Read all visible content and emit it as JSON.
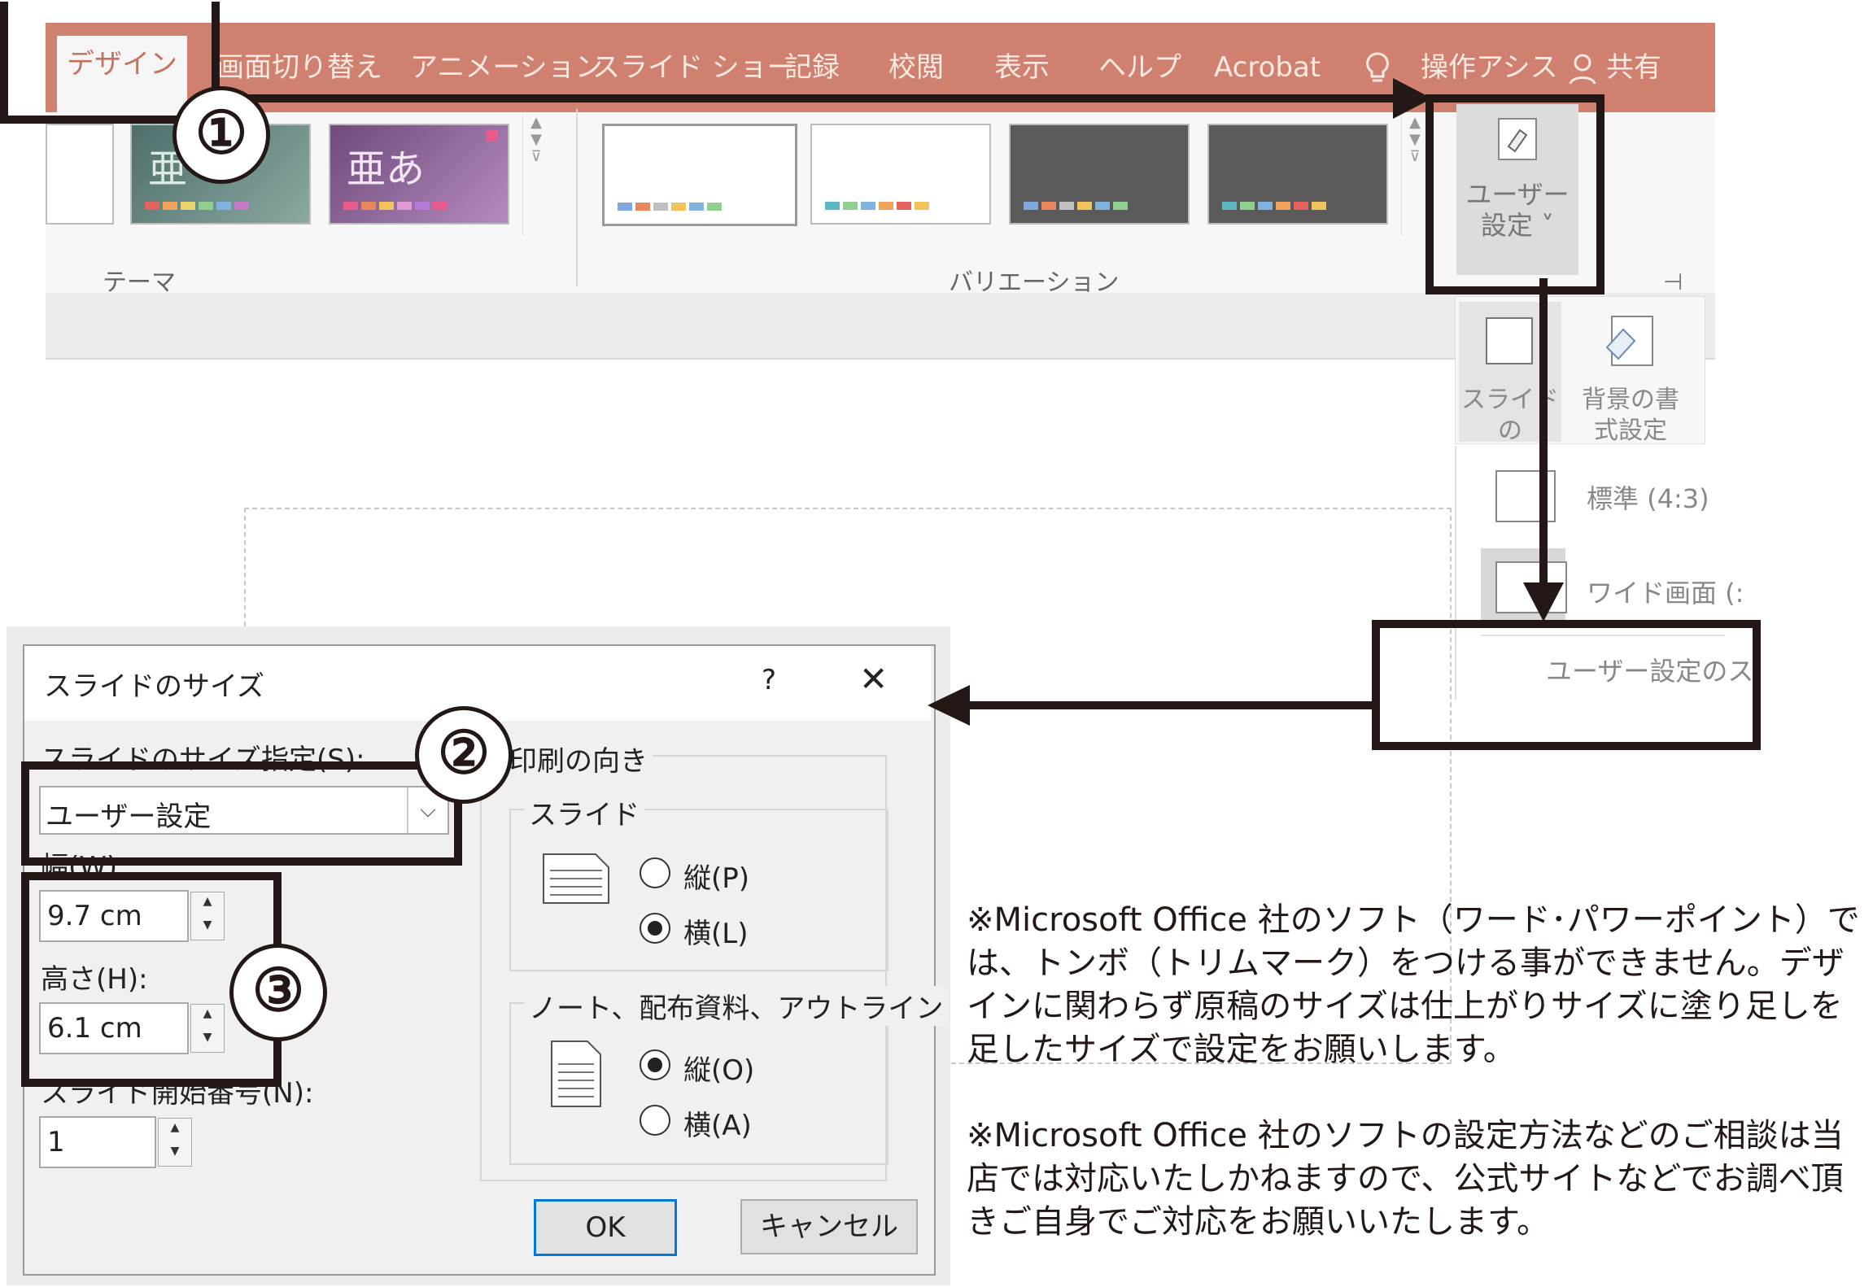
{
  "ribbon": {
    "tabs": [
      "デザイン",
      "画面切り替え",
      "アニメーション",
      "スライド ショー",
      "記録",
      "校閲",
      "表示",
      "ヘルプ",
      "Acrobat",
      "操作アシス",
      "共有"
    ],
    "active_tab": "デザイン",
    "groups": {
      "theme_label": "テーマ",
      "variation_label": "バリエーション"
    },
    "theme_sample_text": "亜あ",
    "theme_sample_text_partial": "亜",
    "customize_button": "ユーザー\n設定 ˅",
    "slide_size_button": "スライドの\nサイズ ˅",
    "background_button": "背景の書\n式設定"
  },
  "size_menu": {
    "items": [
      "標準 (4:3)",
      "ワイド画面 (:",
      "ユーザー設定のス"
    ]
  },
  "dialog": {
    "title": "スライドのサイズ",
    "help": "?",
    "close": "✕",
    "size_spec_label": "スライドのサイズ指定(S):",
    "size_spec_value": "ユーザー設定",
    "width_label": "幅(W):",
    "width_value": "9.7 cm",
    "height_label": "高さ(H):",
    "height_value": "6.1 cm",
    "start_number_label": "スライド開始番号(N):",
    "start_number_value": "1",
    "orientation_label": "印刷の向き",
    "slide_group_label": "スライド",
    "slide_portrait": "縦(P)",
    "slide_landscape": "横(L)",
    "notes_group_label": "ノート、配布資料、アウトライン",
    "notes_portrait": "縦(O)",
    "notes_landscape": "横(A)",
    "ok": "OK",
    "cancel": "キャンセル"
  },
  "steps": [
    "①",
    "②",
    "③"
  ],
  "notes": [
    "※Microsoft Office 社のソフト（ワード･パワーポイント）では、トンボ（トリムマーク）をつける事ができません。デザインに関わらず原稿のサイズは仕上がりサイズに塗り足しを足したサイズで設定をお願いします。",
    "※Microsoft Office 社のソフトの設定方法などのご相談は当店では対応いたしかねますので、公式サイトなどでお調べ頂きご自身でご対応をお願いいたします。"
  ],
  "colors": {
    "ribbon": "#d0806e",
    "annotation": "#231815",
    "ok_border": "#0078d7"
  }
}
